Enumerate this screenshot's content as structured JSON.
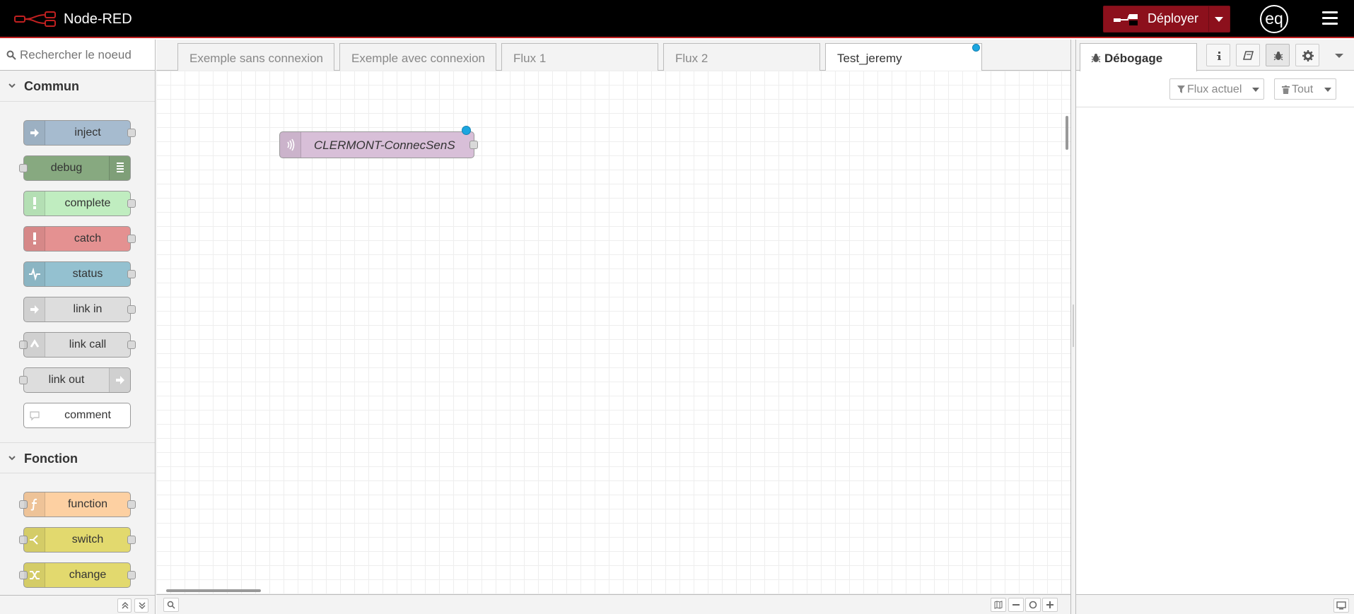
{
  "header": {
    "title": "Node-RED",
    "deploy_label": "Déployer",
    "user_initials": "eq",
    "brand_color": "#8c101c"
  },
  "palette": {
    "search_placeholder": "Rechercher le noeud",
    "categories": [
      {
        "label": "Commun",
        "nodes": [
          {
            "label": "inject",
            "color": "#a6bbcf"
          },
          {
            "label": "debug",
            "color": "#87a980"
          },
          {
            "label": "complete",
            "color": "#c0edc0"
          },
          {
            "label": "catch",
            "color": "#e49191"
          },
          {
            "label": "status",
            "color": "#94c1d0"
          },
          {
            "label": "link in",
            "color": "#dddddd"
          },
          {
            "label": "link call",
            "color": "#dddddd"
          },
          {
            "label": "link out",
            "color": "#dddddd"
          },
          {
            "label": "comment",
            "color": "#ffffff"
          }
        ]
      },
      {
        "label": "Fonction",
        "nodes": [
          {
            "label": "function",
            "color": "#fdd0a2"
          },
          {
            "label": "switch",
            "color": "#e2d96e"
          },
          {
            "label": "change",
            "color": "#e2d96e"
          }
        ]
      }
    ]
  },
  "workspace": {
    "tabs": [
      {
        "label": "Exemple sans connexion",
        "active": false
      },
      {
        "label": "Exemple avec connexion",
        "active": false
      },
      {
        "label": "Flux 1",
        "active": false
      },
      {
        "label": "Flux 2",
        "active": false
      },
      {
        "label": "Test_jeremy",
        "active": true
      }
    ],
    "nodes": [
      {
        "label": "CLERMONT-ConnecSenS",
        "color": "#d8bfd8",
        "changed": true
      }
    ]
  },
  "sidebar": {
    "active_tab": "Débogage",
    "filter_label": "Flux actuel",
    "clear_label": "Tout"
  }
}
